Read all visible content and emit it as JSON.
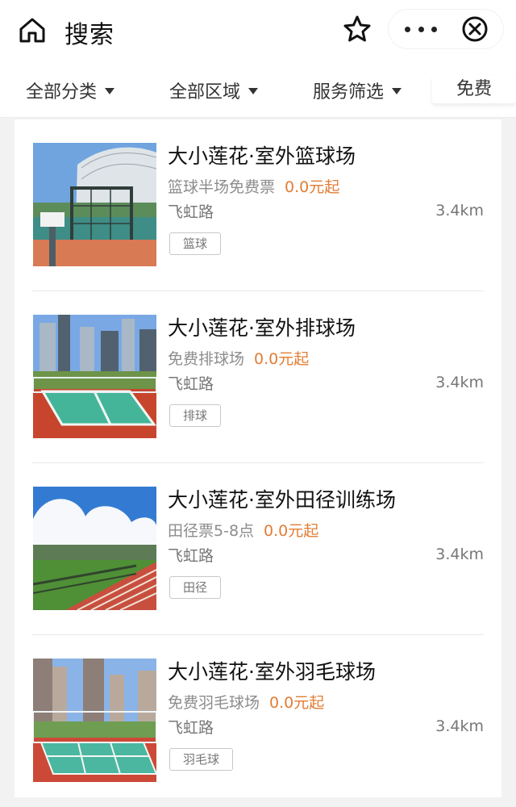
{
  "header": {
    "title": "搜索"
  },
  "filters": [
    "全部分类",
    "全部区域",
    "服务筛选"
  ],
  "filter_free": "免费",
  "venues": [
    {
      "name": "大小莲花·室外篮球场",
      "desc": "篮球半场免费票",
      "price": "0.0元起",
      "road": "飞虹路",
      "distance": "3.4km",
      "tag": "篮球"
    },
    {
      "name": "大小莲花·室外排球场",
      "desc": "免费排球场",
      "price": "0.0元起",
      "road": "飞虹路",
      "distance": "3.4km",
      "tag": "排球"
    },
    {
      "name": "大小莲花·室外田径训练场",
      "desc": "田径票5-8点",
      "price": "0.0元起",
      "road": "飞虹路",
      "distance": "3.4km",
      "tag": "田径"
    },
    {
      "name": "大小莲花·室外羽毛球场",
      "desc": "免费羽毛球场",
      "price": "0.0元起",
      "road": "飞虹路",
      "distance": "3.4km",
      "tag": "羽毛球"
    }
  ]
}
